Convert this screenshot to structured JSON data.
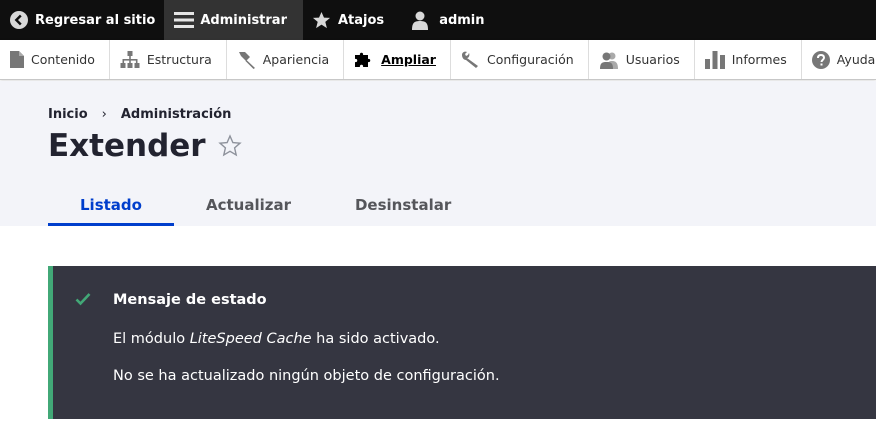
{
  "toolbar": {
    "back_label": "Regresar al sitio",
    "admin_label": "Administrar",
    "shortcuts_label": "Atajos",
    "user_label": "admin"
  },
  "tray": {
    "items": [
      {
        "label": "Contenido",
        "icon": "file-icon"
      },
      {
        "label": "Estructura",
        "icon": "sitemap-icon"
      },
      {
        "label": "Apariencia",
        "icon": "paintbrush-icon"
      },
      {
        "label": "Ampliar",
        "icon": "puzzle-icon",
        "active": true
      },
      {
        "label": "Configuración",
        "icon": "wrench-icon"
      },
      {
        "label": "Usuarios",
        "icon": "people-icon"
      },
      {
        "label": "Informes",
        "icon": "bar-chart-icon"
      },
      {
        "label": "Ayuda",
        "icon": "help-icon"
      }
    ]
  },
  "breadcrumb": {
    "home": "Inicio",
    "separator": "›",
    "admin": "Administración"
  },
  "page": {
    "title": "Extender"
  },
  "tabs": [
    {
      "label": "Listado",
      "active": true
    },
    {
      "label": "Actualizar"
    },
    {
      "label": "Desinstalar"
    }
  ],
  "message": {
    "title": "Mensaje de estado",
    "line1_prefix": "El módulo ",
    "line1_module": "LiteSpeed Cache",
    "line1_suffix": " ha sido activado.",
    "line2": "No se ha actualizado ningún objeto de configuración."
  },
  "colors": {
    "toolbar_bg": "#0f0f0f",
    "active_tab": "#003ecc",
    "message_bg": "#353641",
    "message_accent": "#42a877"
  }
}
